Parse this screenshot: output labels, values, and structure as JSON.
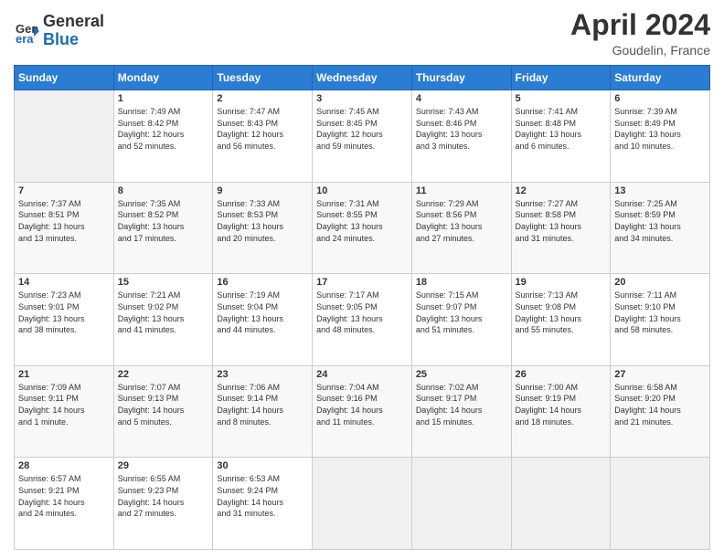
{
  "header": {
    "logo_line1": "General",
    "logo_line2": "Blue",
    "month_title": "April 2024",
    "location": "Goudelin, France"
  },
  "days_of_week": [
    "Sunday",
    "Monday",
    "Tuesday",
    "Wednesday",
    "Thursday",
    "Friday",
    "Saturday"
  ],
  "weeks": [
    [
      {
        "day": "",
        "info": ""
      },
      {
        "day": "1",
        "info": "Sunrise: 7:49 AM\nSunset: 8:42 PM\nDaylight: 12 hours\nand 52 minutes."
      },
      {
        "day": "2",
        "info": "Sunrise: 7:47 AM\nSunset: 8:43 PM\nDaylight: 12 hours\nand 56 minutes."
      },
      {
        "day": "3",
        "info": "Sunrise: 7:45 AM\nSunset: 8:45 PM\nDaylight: 12 hours\nand 59 minutes."
      },
      {
        "day": "4",
        "info": "Sunrise: 7:43 AM\nSunset: 8:46 PM\nDaylight: 13 hours\nand 3 minutes."
      },
      {
        "day": "5",
        "info": "Sunrise: 7:41 AM\nSunset: 8:48 PM\nDaylight: 13 hours\nand 6 minutes."
      },
      {
        "day": "6",
        "info": "Sunrise: 7:39 AM\nSunset: 8:49 PM\nDaylight: 13 hours\nand 10 minutes."
      }
    ],
    [
      {
        "day": "7",
        "info": "Sunrise: 7:37 AM\nSunset: 8:51 PM\nDaylight: 13 hours\nand 13 minutes."
      },
      {
        "day": "8",
        "info": "Sunrise: 7:35 AM\nSunset: 8:52 PM\nDaylight: 13 hours\nand 17 minutes."
      },
      {
        "day": "9",
        "info": "Sunrise: 7:33 AM\nSunset: 8:53 PM\nDaylight: 13 hours\nand 20 minutes."
      },
      {
        "day": "10",
        "info": "Sunrise: 7:31 AM\nSunset: 8:55 PM\nDaylight: 13 hours\nand 24 minutes."
      },
      {
        "day": "11",
        "info": "Sunrise: 7:29 AM\nSunset: 8:56 PM\nDaylight: 13 hours\nand 27 minutes."
      },
      {
        "day": "12",
        "info": "Sunrise: 7:27 AM\nSunset: 8:58 PM\nDaylight: 13 hours\nand 31 minutes."
      },
      {
        "day": "13",
        "info": "Sunrise: 7:25 AM\nSunset: 8:59 PM\nDaylight: 13 hours\nand 34 minutes."
      }
    ],
    [
      {
        "day": "14",
        "info": "Sunrise: 7:23 AM\nSunset: 9:01 PM\nDaylight: 13 hours\nand 38 minutes."
      },
      {
        "day": "15",
        "info": "Sunrise: 7:21 AM\nSunset: 9:02 PM\nDaylight: 13 hours\nand 41 minutes."
      },
      {
        "day": "16",
        "info": "Sunrise: 7:19 AM\nSunset: 9:04 PM\nDaylight: 13 hours\nand 44 minutes."
      },
      {
        "day": "17",
        "info": "Sunrise: 7:17 AM\nSunset: 9:05 PM\nDaylight: 13 hours\nand 48 minutes."
      },
      {
        "day": "18",
        "info": "Sunrise: 7:15 AM\nSunset: 9:07 PM\nDaylight: 13 hours\nand 51 minutes."
      },
      {
        "day": "19",
        "info": "Sunrise: 7:13 AM\nSunset: 9:08 PM\nDaylight: 13 hours\nand 55 minutes."
      },
      {
        "day": "20",
        "info": "Sunrise: 7:11 AM\nSunset: 9:10 PM\nDaylight: 13 hours\nand 58 minutes."
      }
    ],
    [
      {
        "day": "21",
        "info": "Sunrise: 7:09 AM\nSunset: 9:11 PM\nDaylight: 14 hours\nand 1 minute."
      },
      {
        "day": "22",
        "info": "Sunrise: 7:07 AM\nSunset: 9:13 PM\nDaylight: 14 hours\nand 5 minutes."
      },
      {
        "day": "23",
        "info": "Sunrise: 7:06 AM\nSunset: 9:14 PM\nDaylight: 14 hours\nand 8 minutes."
      },
      {
        "day": "24",
        "info": "Sunrise: 7:04 AM\nSunset: 9:16 PM\nDaylight: 14 hours\nand 11 minutes."
      },
      {
        "day": "25",
        "info": "Sunrise: 7:02 AM\nSunset: 9:17 PM\nDaylight: 14 hours\nand 15 minutes."
      },
      {
        "day": "26",
        "info": "Sunrise: 7:00 AM\nSunset: 9:19 PM\nDaylight: 14 hours\nand 18 minutes."
      },
      {
        "day": "27",
        "info": "Sunrise: 6:58 AM\nSunset: 9:20 PM\nDaylight: 14 hours\nand 21 minutes."
      }
    ],
    [
      {
        "day": "28",
        "info": "Sunrise: 6:57 AM\nSunset: 9:21 PM\nDaylight: 14 hours\nand 24 minutes."
      },
      {
        "day": "29",
        "info": "Sunrise: 6:55 AM\nSunset: 9:23 PM\nDaylight: 14 hours\nand 27 minutes."
      },
      {
        "day": "30",
        "info": "Sunrise: 6:53 AM\nSunset: 9:24 PM\nDaylight: 14 hours\nand 31 minutes."
      },
      {
        "day": "",
        "info": ""
      },
      {
        "day": "",
        "info": ""
      },
      {
        "day": "",
        "info": ""
      },
      {
        "day": "",
        "info": ""
      }
    ]
  ]
}
